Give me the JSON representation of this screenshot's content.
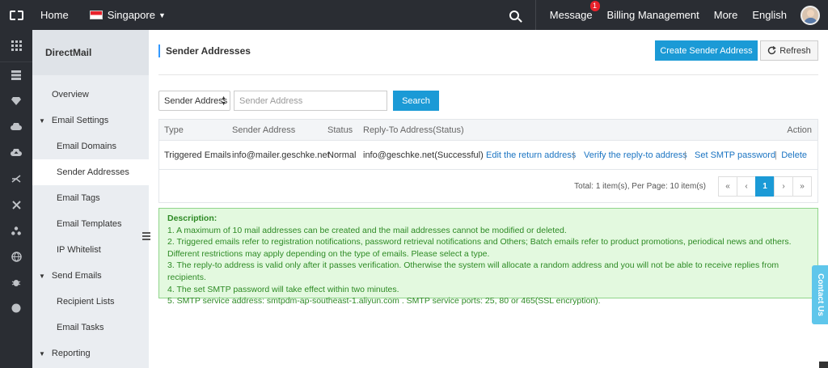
{
  "topbar": {
    "home": "Home",
    "region": "Singapore",
    "message": "Message",
    "message_badge": "1",
    "billing": "Billing Management",
    "more": "More",
    "language": "English"
  },
  "rail": {
    "icons": [
      "grid-icon",
      "server-icon",
      "gem-icon",
      "cloud-icon",
      "cloud-upload-icon",
      "network-icon",
      "cross-icon",
      "cluster-icon",
      "globe-icon",
      "bug-icon",
      "circle-icon"
    ]
  },
  "sidebar": {
    "title": "DirectMail",
    "items": [
      {
        "label": "Overview",
        "kind": "item"
      },
      {
        "label": "Email Settings",
        "kind": "group"
      },
      {
        "label": "Email Domains",
        "kind": "sub"
      },
      {
        "label": "Sender Addresses",
        "kind": "sub",
        "active": true
      },
      {
        "label": "Email Tags",
        "kind": "sub"
      },
      {
        "label": "Email Templates",
        "kind": "sub"
      },
      {
        "label": "IP Whitelist",
        "kind": "sub"
      },
      {
        "label": "Send Emails",
        "kind": "group"
      },
      {
        "label": "Recipient Lists",
        "kind": "sub"
      },
      {
        "label": "Email Tasks",
        "kind": "sub"
      },
      {
        "label": "Reporting",
        "kind": "group"
      }
    ]
  },
  "main": {
    "title": "Sender Addresses",
    "create_label": "Create Sender Address",
    "refresh_label": "Refresh",
    "filter": {
      "select_value": "Sender Address",
      "input_placeholder": "Sender Address",
      "search_label": "Search"
    },
    "table": {
      "headers": {
        "type": "Type",
        "sender": "Sender Address",
        "status": "Status",
        "reply": "Reply-To Address(Status)",
        "action": "Action"
      },
      "rows": [
        {
          "type": "Triggered Emails",
          "sender": "info@mailer.geschke.net",
          "status": "Normal",
          "reply": "info@geschke.net(Successful)",
          "actions": [
            "Edit the return address",
            "Verify the reply-to address",
            "Set SMTP password",
            "Delete"
          ]
        }
      ],
      "total": "Total: 1 item(s), Per Page: 10 item(s)",
      "pager": {
        "first": "«",
        "prev": "‹",
        "current": "1",
        "next": "›",
        "last": "»"
      }
    },
    "description": {
      "title": "Description:",
      "lines": [
        "1. A maximum of 10 mail addresses can be created and the mail addresses cannot be modified or deleted.",
        "2. Triggered emails refer to registration notifications, password retrieval notifications and Others; Batch emails refer to product promotions, periodical news and others. Different restrictions may apply depending on the type of emails. Please select a type.",
        "3. The reply-to address is valid only after it passes verification. Otherwise the system will allocate a random address and you will not be able to receive replies from recipients.",
        "4. The set SMTP password will take effect within two minutes.",
        "5. SMTP service address: smtpdm-ap-southeast-1.aliyun.com . SMTP service ports: 25, 80 or 465(SSL encryption)."
      ]
    }
  },
  "contact_us": "Contact Us"
}
